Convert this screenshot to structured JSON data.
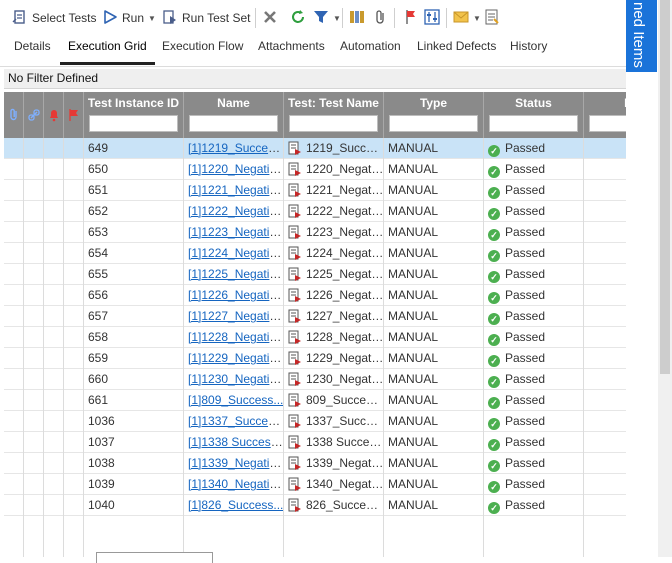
{
  "toolbar": {
    "select_tests": "Select Tests",
    "run": "Run",
    "run_test_set": "Run Test Set"
  },
  "tabs": [
    "Details",
    "Execution Grid",
    "Execution Flow",
    "Attachments",
    "Automation",
    "Linked Defects",
    "History"
  ],
  "active_tab": "Execution Grid",
  "filter_text": "No Filter Defined",
  "side_panel_label": "ned Items",
  "columns": {
    "test_instance_id": "Test Instance ID",
    "name": "Name",
    "test_name": "Test: Test Name",
    "type": "Type",
    "status": "Status",
    "item": "Iter"
  },
  "rows": [
    {
      "id": "649",
      "name": "[1]1219_Success...",
      "test_name": "1219_Succes...",
      "type": "MANUAL",
      "status": "Passed"
    },
    {
      "id": "650",
      "name": "[1]1220_Negativ...",
      "test_name": "1220_Negativ...",
      "type": "MANUAL",
      "status": "Passed"
    },
    {
      "id": "651",
      "name": "[1]1221_Negativ...",
      "test_name": "1221_Negativ...",
      "type": "MANUAL",
      "status": "Passed"
    },
    {
      "id": "652",
      "name": "[1]1222_Negativ...",
      "test_name": "1222_Negativ...",
      "type": "MANUAL",
      "status": "Passed"
    },
    {
      "id": "653",
      "name": "[1]1223_Negativ...",
      "test_name": "1223_Negativ...",
      "type": "MANUAL",
      "status": "Passed"
    },
    {
      "id": "654",
      "name": "[1]1224_Negativ...",
      "test_name": "1224_Negativ...",
      "type": "MANUAL",
      "status": "Passed"
    },
    {
      "id": "655",
      "name": "[1]1225_Negativ...",
      "test_name": "1225_Negativ...",
      "type": "MANUAL",
      "status": "Passed"
    },
    {
      "id": "656",
      "name": "[1]1226_Negativ...",
      "test_name": "1226_Negativ...",
      "type": "MANUAL",
      "status": "Passed"
    },
    {
      "id": "657",
      "name": "[1]1227_Negativ...",
      "test_name": "1227_Negativ...",
      "type": "MANUAL",
      "status": "Passed"
    },
    {
      "id": "658",
      "name": "[1]1228_Negativ...",
      "test_name": "1228_Negativ...",
      "type": "MANUAL",
      "status": "Passed"
    },
    {
      "id": "659",
      "name": "[1]1229_Negativ...",
      "test_name": "1229_Negativ...",
      "type": "MANUAL",
      "status": "Passed"
    },
    {
      "id": "660",
      "name": "[1]1230_Negativ...",
      "test_name": "1230_Negativ...",
      "type": "MANUAL",
      "status": "Passed"
    },
    {
      "id": "661",
      "name": "[1]809_Success...",
      "test_name": "809_Success...",
      "type": "MANUAL",
      "status": "Passed"
    },
    {
      "id": "1036",
      "name": "[1]1337_Success...",
      "test_name": "1337_Succes...",
      "type": "MANUAL",
      "status": "Passed"
    },
    {
      "id": "1037",
      "name": "[1]1338 Success...",
      "test_name": "1338 Success...",
      "type": "MANUAL",
      "status": "Passed"
    },
    {
      "id": "1038",
      "name": "[1]1339_Negativ...",
      "test_name": "1339_Negativ...",
      "type": "MANUAL",
      "status": "Passed"
    },
    {
      "id": "1039",
      "name": "[1]1340_Negativ...",
      "test_name": "1340_Negativ...",
      "type": "MANUAL",
      "status": "Passed"
    },
    {
      "id": "1040",
      "name": "[1]826_Success...",
      "test_name": "826_Success...",
      "type": "MANUAL",
      "status": "Passed"
    }
  ],
  "colors": {
    "header_bg": "#8a8a8a",
    "selected_row": "#c9e3f7",
    "link": "#1565c0",
    "passed": "#4caf50",
    "accent_blue": "#1a73d9"
  }
}
